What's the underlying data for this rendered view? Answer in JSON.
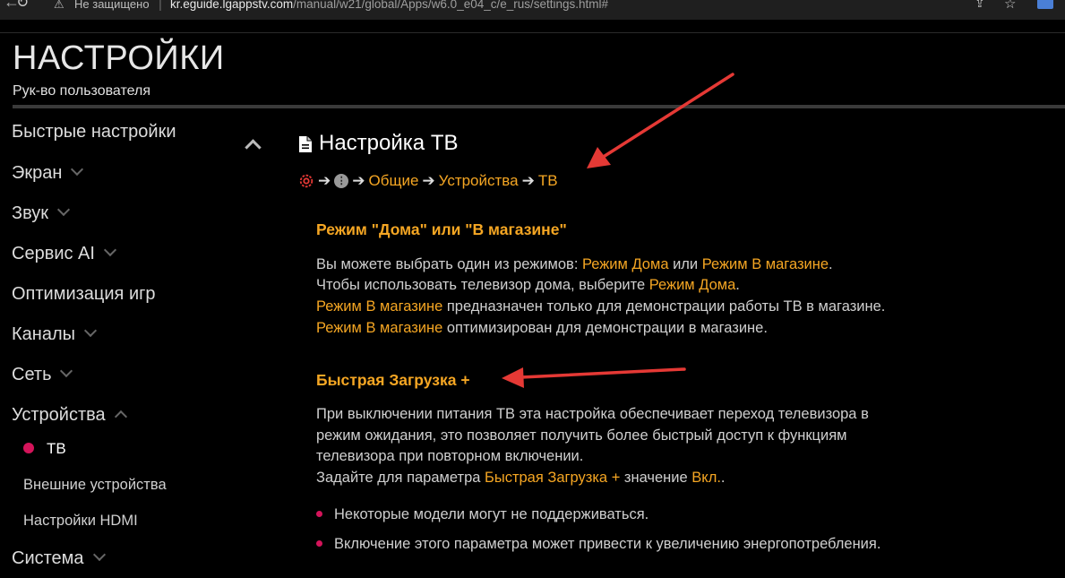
{
  "browser": {
    "security_label": "Не защищено",
    "url_host": "kr.eguide.lgappstv.com",
    "url_path": "/manual/w21/global/Apps/w6.0_e04_c/e_rus/settings.html#"
  },
  "header": {
    "title": "НАСТРОЙКИ",
    "subtitle": "Рук-во пользователя"
  },
  "sidebar": {
    "items": [
      {
        "label": "Быстрые настройки"
      },
      {
        "label": "Экран"
      },
      {
        "label": "Звук"
      },
      {
        "label": "Сервис AI"
      },
      {
        "label": "Оптимизация игр"
      },
      {
        "label": "Каналы"
      },
      {
        "label": "Сеть"
      },
      {
        "label": "Устройства"
      },
      {
        "label": "Система"
      }
    ],
    "sub_items": [
      {
        "label": "ТВ"
      },
      {
        "label": "Внешние устройства"
      },
      {
        "label": "Настройки HDMI"
      }
    ]
  },
  "main": {
    "title": "Настройка ТВ",
    "breadcrumb": [
      "Общие",
      "Устройства",
      "ТВ"
    ],
    "section1": {
      "title": "Режим \"Дома\" или \"В магазине\"",
      "line1_a": "Вы можете выбрать один из режимов: ",
      "line1_b": "Режим Дома",
      "line1_c": " или ",
      "line1_d": "Режим В магазине",
      "line1_e": ".",
      "line2_a": "Чтобы использовать телевизор дома, выберите ",
      "line2_b": "Режим Дома",
      "line2_c": ".",
      "line3_a": "Режим В магазине",
      "line3_b": " предназначен только для демонстрации работы ТВ в магазине.",
      "line4_a": "Режим В магазине",
      "line4_b": " оптимизирован для демонстрации в магазине."
    },
    "section2": {
      "title": "Быстрая Загрузка +",
      "line1": "При выключении питания ТВ эта настройка обеспечивает переход телевизора в",
      "line2": "режим ожидания, это позволяет получить более быстрый доступ к функциям",
      "line3": "телевизора при повторном включении.",
      "line4_a": "Задайте для параметра ",
      "line4_b": "Быстрая Загрузка +",
      "line4_c": " значение ",
      "line4_d": "Вкл.",
      "line4_e": ".",
      "bullets": [
        "Некоторые модели могут не поддерживаться.",
        "Включение этого параметра может привести к увеличению энергопотребления."
      ]
    }
  },
  "colors": {
    "accent": "#f5a623",
    "active_dot": "#d4145a",
    "annotation_arrow": "#e53935"
  }
}
